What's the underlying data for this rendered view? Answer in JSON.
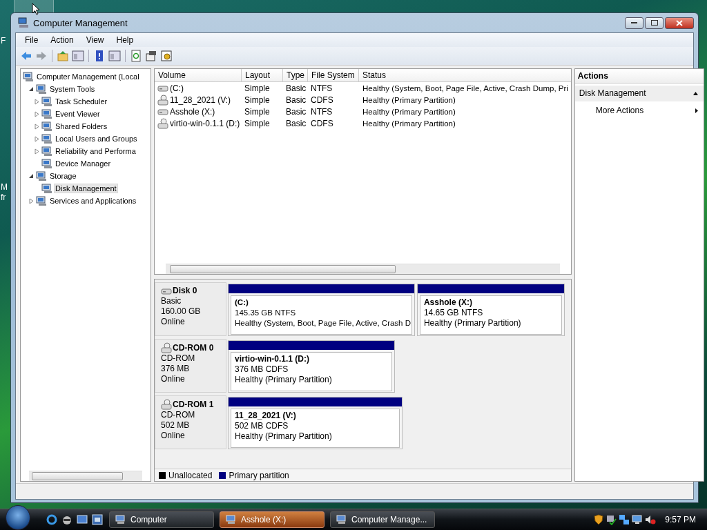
{
  "desktop": {
    "icon_labels": [
      {
        "label": "F"
      },
      {
        "label": "M"
      },
      {
        "label": "fr"
      }
    ]
  },
  "window": {
    "title": "Computer Management"
  },
  "menu": [
    "File",
    "Action",
    "View",
    "Help"
  ],
  "tree": [
    {
      "label": "Computer Management (Local",
      "selected": false,
      "children": [
        {
          "label": "System Tools",
          "selected": false,
          "expanded": true,
          "children": [
            {
              "label": "Task Scheduler",
              "selected": false,
              "expanded": false
            },
            {
              "label": "Event Viewer",
              "selected": false,
              "expanded": false
            },
            {
              "label": "Shared Folders",
              "selected": false,
              "expanded": false
            },
            {
              "label": "Local Users and Groups",
              "selected": false,
              "expanded": false
            },
            {
              "label": "Reliability and Performa",
              "selected": false,
              "expanded": false
            },
            {
              "label": "Device Manager",
              "selected": false
            }
          ]
        },
        {
          "label": "Storage",
          "selected": false,
          "expanded": true,
          "children": [
            {
              "label": "Disk Management",
              "selected": true
            }
          ]
        },
        {
          "label": "Services and Applications",
          "selected": false,
          "expanded": false
        }
      ]
    }
  ],
  "volumes": {
    "columns": [
      "Volume",
      "Layout",
      "Type",
      "File System",
      "Status"
    ],
    "rows": [
      {
        "kind": "disk",
        "cells": [
          "(C:)",
          "Simple",
          "Basic",
          "NTFS",
          "Healthy (System, Boot, Page File, Active, Crash Dump, Pri"
        ]
      },
      {
        "kind": "cd",
        "cells": [
          "11_28_2021 (V:)",
          "Simple",
          "Basic",
          "CDFS",
          "Healthy (Primary Partition)"
        ]
      },
      {
        "kind": "disk",
        "cells": [
          "Asshole (X:)",
          "Simple",
          "Basic",
          "NTFS",
          "Healthy (Primary Partition)"
        ]
      },
      {
        "kind": "cd",
        "cells": [
          "virtio-win-0.1.1 (D:)",
          "Simple",
          "Basic",
          "CDFS",
          "Healthy (Primary Partition)"
        ]
      }
    ]
  },
  "disks": [
    {
      "kind": "disk",
      "name": "Disk 0",
      "type": "Basic",
      "size": "160.00 GB",
      "status": "Online",
      "partitions": [
        {
          "label": "(C:)",
          "capacity": "145.35 GB NTFS",
          "status": "Healthy (System, Boot, Page File, Active, Crash D"
        },
        {
          "label": "Asshole  (X:)",
          "capacity": "14.65 GB NTFS",
          "status": "Healthy (Primary Partition)"
        }
      ]
    },
    {
      "kind": "cd",
      "name": "CD-ROM 0",
      "type": "CD-ROM",
      "size": "376 MB",
      "status": "Online",
      "partitions": [
        {
          "label": "virtio-win-0.1.1  (D:)",
          "capacity": "376 MB CDFS",
          "status": "Healthy (Primary Partition)"
        }
      ]
    },
    {
      "kind": "cd",
      "name": "CD-ROM 1",
      "type": "CD-ROM",
      "size": "502 MB",
      "status": "Online",
      "partitions": [
        {
          "label": "11_28_2021  (V:)",
          "capacity": "502 MB CDFS",
          "status": "Healthy (Primary Partition)"
        }
      ]
    }
  ],
  "legend": [
    {
      "label": "Unallocated",
      "color": "#000000"
    },
    {
      "label": "Primary partition",
      "color": "#000080"
    }
  ],
  "actions": {
    "title": "Actions",
    "section": "Disk Management",
    "items": [
      "More Actions"
    ]
  },
  "taskbar": {
    "tasks": [
      {
        "label": "Computer",
        "selected": false
      },
      {
        "label": "Asshole (X:)",
        "selected": true
      },
      {
        "label": "Computer Manage...",
        "selected": false
      }
    ],
    "clock": "9:57 PM"
  }
}
